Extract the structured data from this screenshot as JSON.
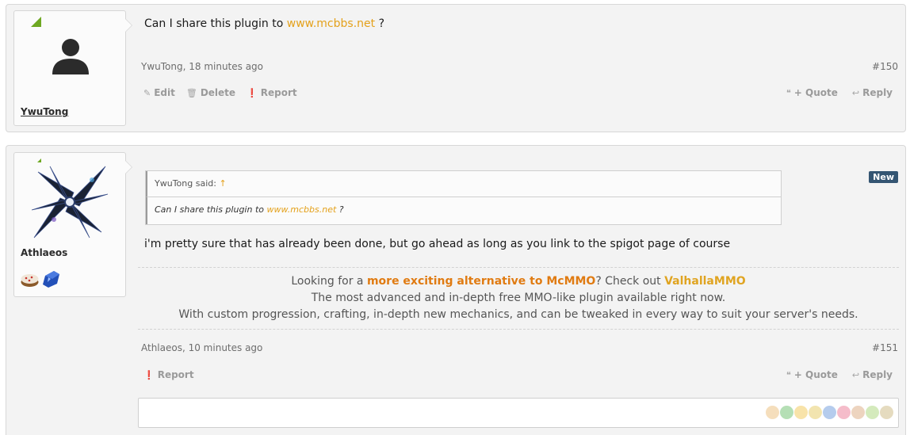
{
  "posts": [
    {
      "author": "YwuTong",
      "message_prefix": "Can I share this plugin to",
      "message_link": "www.mcbbs.net",
      "message_suffix": " ?",
      "meta": "YwuTong, 18 minutes ago",
      "number": "#150",
      "actions": {
        "edit": "Edit",
        "delete": "Delete",
        "report": "Report",
        "quote": "+ Quote",
        "reply": "Reply"
      }
    },
    {
      "author": "Athlaeos",
      "badge": "New",
      "quote": {
        "author_line": "YwuTong said:",
        "jump_arrow": "↑",
        "text_prefix": "Can I share this plugin to",
        "text_link": "www.mcbbs.net",
        "text_suffix": " ?"
      },
      "message": "i'm pretty sure that has already been done, but go ahead as long as you link to the spigot page of course",
      "signature": {
        "line1_a": "Looking for a ",
        "line1_b": "more exciting alternative to McMMO",
        "line1_c": "? Check out ",
        "line1_d": "ValhallaMMO",
        "line2": "The most advanced and in-depth free MMO-like plugin available right now.",
        "line3": "With custom progression, crafting, in-depth new mechanics, and can be tweaked in every way to suit your server's needs."
      },
      "meta": "Athlaeos, 10 minutes ago",
      "number": "#151",
      "actions": {
        "report": "Report",
        "quote": "+ Quote",
        "reply": "Reply"
      }
    }
  ],
  "icons": {
    "edit": "pencil-icon",
    "delete": "trash-icon",
    "report": "warning-icon",
    "quote": "quote-icon",
    "reply": "reply-icon"
  },
  "colors": {
    "link": "#e4a11b",
    "online": "#6ea822",
    "badge": "#345572"
  }
}
